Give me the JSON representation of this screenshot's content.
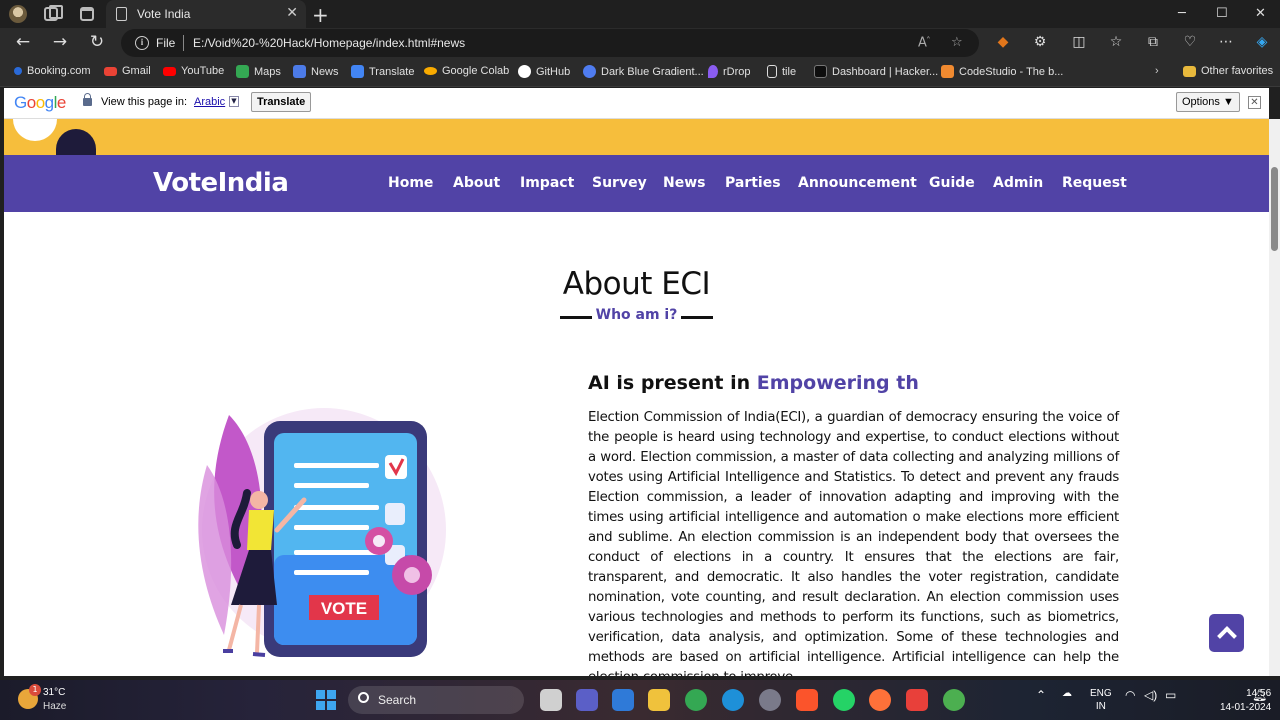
{
  "browser": {
    "tab_title": "Vote India",
    "protocol_label": "File",
    "url": "E:/Void%20-%20Hack/Homepage/index.html#news",
    "bookmarks": [
      {
        "label": "Booking.com",
        "color": "#2a6ad8"
      },
      {
        "label": "Gmail",
        "color": "#ea4335"
      },
      {
        "label": "YouTube",
        "color": "#ff0000"
      },
      {
        "label": "Maps",
        "color": "#34a853"
      },
      {
        "label": "News",
        "color": "#4c7be8"
      },
      {
        "label": "Translate",
        "color": "#4285f4"
      },
      {
        "label": "Google Colab",
        "color": "#f9ab00"
      },
      {
        "label": "GitHub",
        "color": "#ffffff"
      },
      {
        "label": "Dark Blue Gradient...",
        "color": "#4f7cf0"
      },
      {
        "label": "rDrop",
        "color": "#8a5cf0"
      },
      {
        "label": "tile",
        "color": "#dddddd"
      },
      {
        "label": "Dashboard | Hacker...",
        "color": "#0e0e0e"
      },
      {
        "label": "CodeStudio - The b...",
        "color": "#f08a30"
      }
    ],
    "other_favorites": "Other favorites"
  },
  "translate_bar": {
    "google": "Google",
    "prompt": "View this page in:",
    "language": "Arabic",
    "translate_button": "Translate",
    "options_button": "Options ▼",
    "close": "✕"
  },
  "site": {
    "brand": "VoteIndia",
    "nav": [
      "Home",
      "About",
      "Impact",
      "Survey",
      "News",
      "Parties",
      "Announcement",
      "Guide",
      "Admin",
      "Request"
    ],
    "section_title": "About ECI",
    "section_subtitle": "Who am i?",
    "heading_plain": "AI is present in ",
    "heading_accent": "Empowering th",
    "paragraph": "Election Commission of India(ECI), a guardian of democracy ensuring the voice of the people is heard using technology and expertise, to conduct elections without a word. Election commission, a master of data collecting and analyzing millions of votes using Artificial Intelligence and Statistics. To detect and prevent any frauds Election commission, a leader of innovation adapting and improving with the times using artificial intelligence and automation o make elections more efficient and sublime. An election commission is an independent body that oversees the conduct of elections in a country. It ensures that the elections are fair, transparent, and democratic. It also handles the voter registration, candidate nomination, vote counting, and result declaration. An election commission uses various technologies and methods to perform its functions, such as biometrics, verification, data analysis, and optimization. Some of these technologies and methods are based on artificial intelligence. Artificial intelligence can help the election commission to improve",
    "illustration_label": "VOTE",
    "accent_color": "#5143a6",
    "band_color": "#f6be3c"
  },
  "taskbar": {
    "temperature": "31°C",
    "weather": "Haze",
    "weather_badge": "1",
    "search_label": "Search",
    "language_top": "ENG",
    "language_bottom": "IN",
    "time": "14:56",
    "date": "14-01-2024"
  }
}
